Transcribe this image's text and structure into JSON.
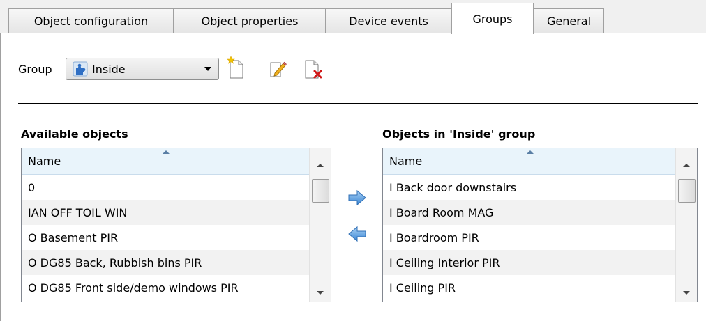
{
  "tabs": [
    {
      "label": "Object configuration",
      "active": false
    },
    {
      "label": "Object properties",
      "active": false
    },
    {
      "label": "Device events",
      "active": false
    },
    {
      "label": "Groups",
      "active": true
    },
    {
      "label": "General",
      "active": false
    }
  ],
  "group": {
    "label": "Group",
    "selected": "Inside",
    "icon": "puzzle-piece-icon",
    "toolbar": {
      "new_icon": "new-document-icon",
      "edit_icon": "edit-pencil-icon",
      "delete_icon": "delete-document-icon"
    }
  },
  "available": {
    "title": "Available objects",
    "column": "Name",
    "items": [
      "0",
      "IAN OFF TOIL WIN",
      "O Basement PIR",
      "O DG85 Back, Rubbish bins PIR",
      "O DG85 Front side/demo windows PIR"
    ]
  },
  "in_group": {
    "title": "Objects in 'Inside' group",
    "column": "Name",
    "items": [
      "I Back door downstairs",
      "I Board Room MAG",
      "I Boardroom PIR",
      "I Ceiling Interior PIR",
      "I Ceiling PIR"
    ]
  },
  "transfer": {
    "add_icon": "arrow-right-icon",
    "remove_icon": "arrow-left-icon"
  },
  "colors": {
    "tab_border": "#a0a0a0",
    "header_bg": "#e9f4fb",
    "arrow_blue": "#4a90d9"
  }
}
